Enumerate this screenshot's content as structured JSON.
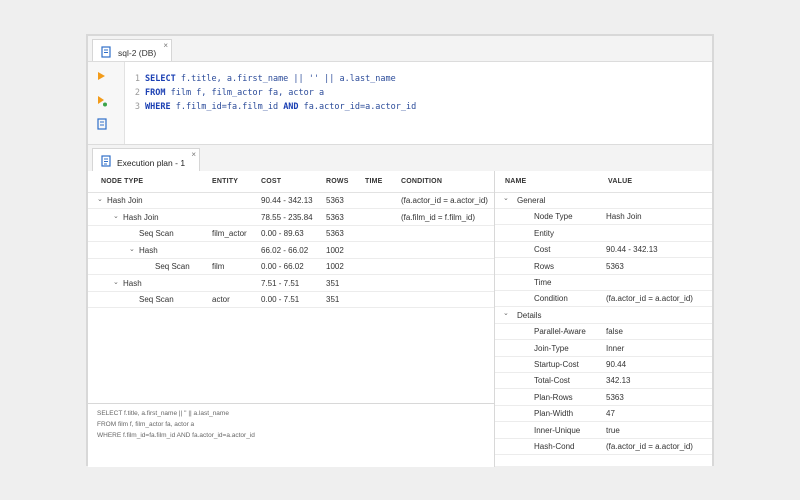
{
  "editor_tab": {
    "label": "sql-2 (DB)",
    "close": "×"
  },
  "code_lines": [
    {
      "num": "1",
      "parts": [
        {
          "t": "SELECT",
          "c": "kw"
        },
        {
          "t": " f.title, a.first_name || '' || a.last_name",
          "c": "tx"
        }
      ]
    },
    {
      "num": "2",
      "parts": [
        {
          "t": "FROM",
          "c": "kw"
        },
        {
          "t": " film f, film_actor fa, actor a",
          "c": "tx"
        }
      ]
    },
    {
      "num": "3",
      "parts": [
        {
          "t": "WHERE",
          "c": "kw"
        },
        {
          "t": " f.film_id=fa.film_id ",
          "c": "tx"
        },
        {
          "t": "AND",
          "c": "kw"
        },
        {
          "t": " fa.actor_id=a.actor_id",
          "c": "tx"
        }
      ]
    }
  ],
  "plan_tab": {
    "label": "Execution plan - 1",
    "close": "×"
  },
  "plan_headers": {
    "node_type": "NODE TYPE",
    "entity": "ENTITY",
    "cost": "COST",
    "rows": "ROWS",
    "time": "TIME",
    "condition": "CONDITION"
  },
  "plan_rows": [
    {
      "indent": 0,
      "expand": true,
      "node": "Hash Join",
      "entity": "",
      "cost": "90.44 - 342.13",
      "rows": "5363",
      "time": "",
      "condition": "(fa.actor_id = a.actor_id)"
    },
    {
      "indent": 1,
      "expand": true,
      "node": "Hash Join",
      "entity": "",
      "cost": "78.55 - 235.84",
      "rows": "5363",
      "time": "",
      "condition": "(fa.film_id = f.film_id)"
    },
    {
      "indent": 2,
      "expand": false,
      "node": "Seq Scan",
      "entity": "film_actor",
      "cost": "0.00 - 89.63",
      "rows": "5363",
      "time": "",
      "condition": ""
    },
    {
      "indent": 2,
      "expand": true,
      "node": "Hash",
      "entity": "",
      "cost": "66.02 - 66.02",
      "rows": "1002",
      "time": "",
      "condition": ""
    },
    {
      "indent": 3,
      "expand": false,
      "node": "Seq Scan",
      "entity": "film",
      "cost": "0.00 - 66.02",
      "rows": "1002",
      "time": "",
      "condition": ""
    },
    {
      "indent": 1,
      "expand": true,
      "node": "Hash",
      "entity": "",
      "cost": "7.51 - 7.51",
      "rows": "351",
      "time": "",
      "condition": ""
    },
    {
      "indent": 2,
      "expand": false,
      "node": "Seq Scan",
      "entity": "actor",
      "cost": "0.00 - 7.51",
      "rows": "351",
      "time": "",
      "condition": ""
    }
  ],
  "sql_preview": [
    "SELECT f.title, a.first_name || '' || a.last_name",
    "FROM film f, film_actor fa, actor a",
    "WHERE f.film_id=fa.film_id AND fa.actor_id=a.actor_id"
  ],
  "props_headers": {
    "name": "NAME",
    "value": "VALUE"
  },
  "props_rows": [
    {
      "group": true,
      "name": "General",
      "value": ""
    },
    {
      "group": false,
      "name": "Node Type",
      "value": "Hash Join"
    },
    {
      "group": false,
      "name": "Entity",
      "value": ""
    },
    {
      "group": false,
      "name": "Cost",
      "value": "90.44 - 342.13"
    },
    {
      "group": false,
      "name": "Rows",
      "value": "5363"
    },
    {
      "group": false,
      "name": "Time",
      "value": ""
    },
    {
      "group": false,
      "name": "Condition",
      "value": "(fa.actor_id = a.actor_id)"
    },
    {
      "group": true,
      "name": "Details",
      "value": ""
    },
    {
      "group": false,
      "name": "Parallel-Aware",
      "value": "false"
    },
    {
      "group": false,
      "name": "Join-Type",
      "value": "Inner"
    },
    {
      "group": false,
      "name": "Startup-Cost",
      "value": "90.44"
    },
    {
      "group": false,
      "name": "Total-Cost",
      "value": "342.13"
    },
    {
      "group": false,
      "name": "Plan-Rows",
      "value": "5363"
    },
    {
      "group": false,
      "name": "Plan-Width",
      "value": "47"
    },
    {
      "group": false,
      "name": "Inner-Unique",
      "value": "true"
    },
    {
      "group": false,
      "name": "Hash-Cond",
      "value": "(fa.actor_id = a.actor_id)"
    }
  ],
  "icons": {
    "expanded": "chevron-down-icon",
    "run": "play-icon",
    "run_script": "play-script-icon",
    "explain": "explain-plan-icon",
    "sql_file": "sql-file-icon",
    "plan": "execution-plan-icon"
  },
  "colors": {
    "keyword": "#1a3fb3",
    "run_icon": "#f29b1a",
    "icon_blue": "#2f6fc9"
  }
}
